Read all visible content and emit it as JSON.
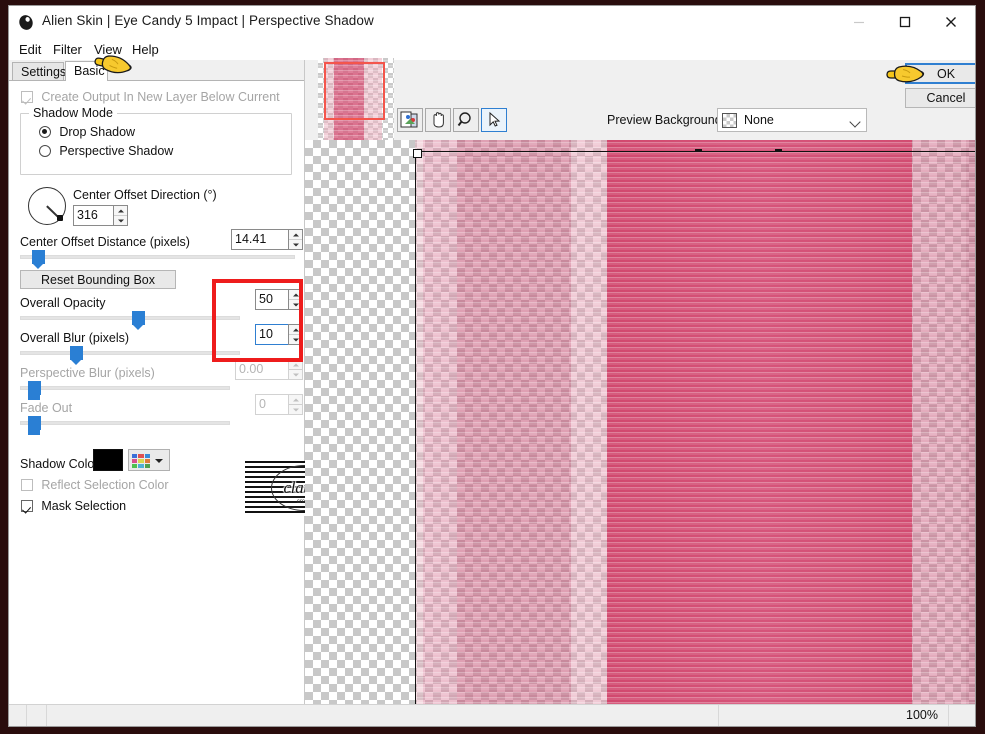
{
  "window": {
    "title": "Alien Skin | Eye Candy 5 Impact | Perspective Shadow",
    "app_icon": "alien-skin-icon",
    "minimize_label": "—",
    "maximize_label": "□",
    "close_label": "✕"
  },
  "menu": {
    "items": [
      {
        "label": "Edit"
      },
      {
        "label": "Filter"
      },
      {
        "label": "View"
      },
      {
        "label": "Help"
      }
    ]
  },
  "tabs": [
    {
      "label": "Settings",
      "active": false
    },
    {
      "label": "Basic",
      "active": true
    }
  ],
  "panel": {
    "create_output": {
      "label": "Create Output In New Layer Below Current",
      "checked": true,
      "enabled": false
    },
    "shadow_mode": {
      "title": "Shadow Mode",
      "options": [
        {
          "label": "Drop Shadow",
          "selected": true
        },
        {
          "label": "Perspective Shadow",
          "selected": false
        }
      ]
    },
    "center_offset_direction": {
      "label": "Center Offset Direction (°)",
      "value": "316",
      "dial_angle_deg": 316
    },
    "center_offset_distance": {
      "label": "Center Offset Distance (pixels)",
      "value": "14.41",
      "slider_pct": 6
    },
    "reset_bounding_box": {
      "label": "Reset Bounding Box"
    },
    "overall_opacity": {
      "label": "Overall Opacity",
      "value": "50",
      "slider_pct": 48
    },
    "overall_blur": {
      "label": "Overall Blur (pixels)",
      "value": "10",
      "slider_pct": 22,
      "focused": true
    },
    "perspective_blur": {
      "label": "Perspective Blur (pixels)",
      "value": "0.00",
      "slider_pct": 4,
      "enabled": false
    },
    "fade_out": {
      "label": "Fade Out",
      "value": "0",
      "slider_pct": 4,
      "enabled": false
    },
    "shadow_color": {
      "label": "Shadow Color",
      "swatch_hex": "#000000",
      "palette_button": "color-palette-icon",
      "palette_colors": [
        "#3a6fd8",
        "#e05050",
        "#3a8ad8",
        "#d84f8c",
        "#d8d84f",
        "#e07a3a",
        "#4fc04f",
        "#4fb0d8",
        "#4f9f4f"
      ]
    },
    "reflect_selection_color": {
      "label": "Reflect Selection Color",
      "checked": false,
      "enabled": false
    },
    "mask_selection": {
      "label": "Mask Selection",
      "checked": true,
      "enabled": true
    }
  },
  "toolbar": {
    "tools": [
      {
        "name": "compare-preview-tool",
        "active": false
      },
      {
        "name": "pan-hand-tool",
        "active": false
      },
      {
        "name": "zoom-magnifier-tool",
        "active": false
      },
      {
        "name": "select-arrow-tool",
        "active": true
      }
    ],
    "preview_background_label": "Preview Background:",
    "preview_background_value": "None"
  },
  "dialog_buttons": {
    "ok": "OK",
    "cancel": "Cancel"
  },
  "statusbar": {
    "zoom": "100%"
  },
  "annotations": {
    "hand_cursor_tab": "pointing-hand-cursor",
    "hand_cursor_ok": "pointing-hand-cursor",
    "red_highlight_values": "red-highlight-box",
    "red_highlight_navigator": "red-highlight-box"
  },
  "watermark": {
    "text": "claudia",
    "subtext": "creations"
  },
  "colors": {
    "accent": "#2f7fd1",
    "highlight_red": "#ee1c1c",
    "slider_blue": "#2a7fd4",
    "image_pink": "#d34f73",
    "image_pink_light": "#e8a8b8",
    "window_border": "#2a0d0d"
  }
}
